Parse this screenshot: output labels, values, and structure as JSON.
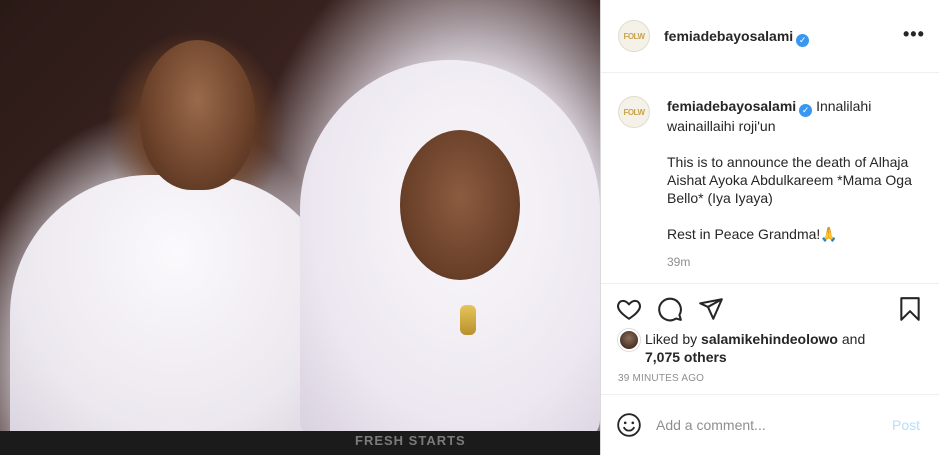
{
  "post": {
    "username": "femiadebayosalami",
    "avatar_text": "FOLW",
    "verified": true,
    "caption_lines": [
      "Innalilahi wainaillaihi roji'un",
      "This is to announce the death of Alhaja Aishat Ayoka Abdulkareem *Mama Oga Bello* (Iya Iyaya)",
      "Rest in Peace Grandma!🙏"
    ],
    "comment_age": "39m",
    "liked_by_prefix": "Liked by",
    "liked_by_user": "salamikehindeolowo",
    "liked_by_and": "and",
    "liked_by_others": "7,075 others",
    "post_time": "39 MINUTES AGO",
    "comment_placeholder": "Add a comment...",
    "post_button": "Post",
    "photo_bottom_text": "FRESH STARTS"
  },
  "colors": {
    "link_blue": "#3897f0",
    "post_button_disabled": "#b2dffc",
    "meta_gray": "#8e8e8e"
  },
  "icons": [
    "more-options-icon",
    "heart-icon",
    "comment-bubble-icon",
    "share-icon",
    "bookmark-icon",
    "emoji-icon",
    "verified-badge-icon"
  ]
}
